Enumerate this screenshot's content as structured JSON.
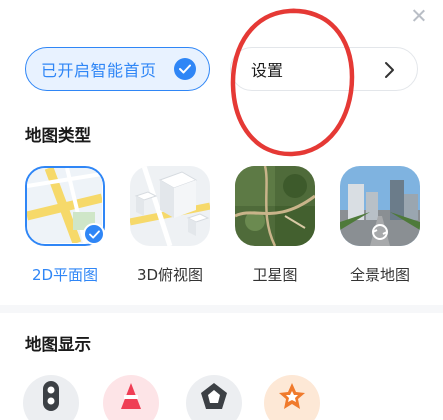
{
  "top": {
    "smart_home_label": "已开启智能首页",
    "settings_label": "设置"
  },
  "sections": {
    "map_type_title": "地图类型",
    "map_display_title": "地图显示"
  },
  "map_types": [
    {
      "label": "2D平面图",
      "selected": true
    },
    {
      "label": "3D俯视图",
      "selected": false
    },
    {
      "label": "卫星图",
      "selected": false
    },
    {
      "label": "全景地图",
      "selected": false
    }
  ],
  "display_icons": [
    "traffic-light-icon",
    "cone-icon",
    "pentagon-icon",
    "star-icon"
  ],
  "colors": {
    "accent": "#2f86f6",
    "annotation": "#e53935"
  }
}
